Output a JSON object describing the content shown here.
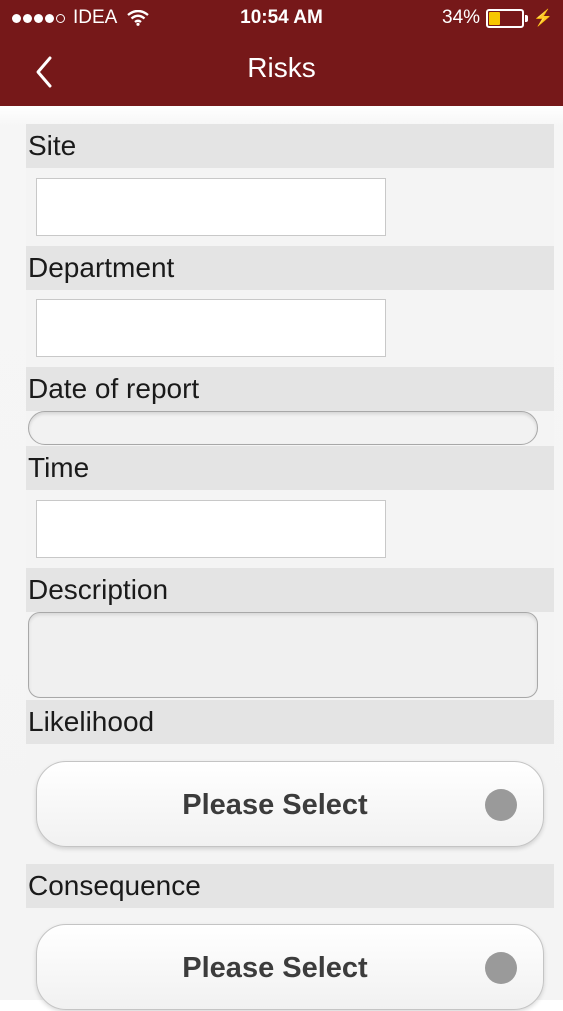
{
  "status_bar": {
    "carrier": "IDEA",
    "time": "10:54 AM",
    "battery": "34%",
    "battery_level": 0.34
  },
  "nav": {
    "title": "Risks",
    "back_icon": "chevron-left-icon"
  },
  "form": {
    "site_label": "Site",
    "department_label": "Department",
    "date_label": "Date of report",
    "time_label": "Time",
    "description_label": "Description",
    "likelihood_label": "Likelihood",
    "likelihood_value": "Please Select",
    "consequence_label": "Consequence",
    "consequence_value": "Please Select"
  },
  "colors": {
    "header": "#761819",
    "label_background": "#e4e4e4"
  }
}
